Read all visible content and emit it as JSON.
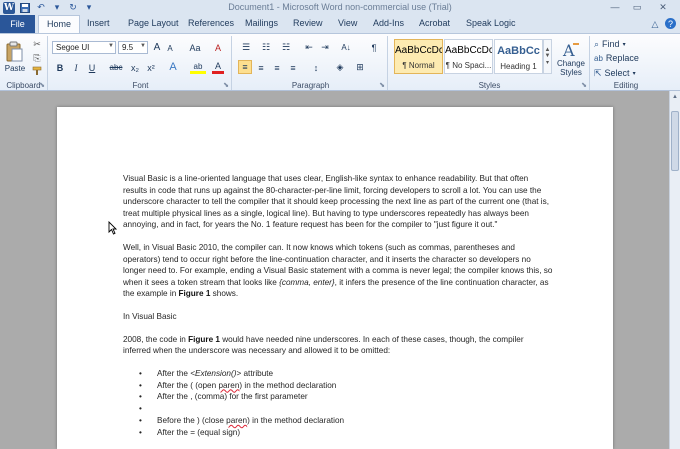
{
  "window": {
    "title": "Document1 - Microsoft Word non-commercial use (Trial)",
    "logo": "W",
    "qat": [
      {
        "name": "save-icon",
        "glyph": "💾"
      },
      {
        "name": "undo-icon",
        "glyph": "↶"
      },
      {
        "name": "redo-icon",
        "glyph": "↻"
      },
      {
        "name": "customize-qat-icon",
        "glyph": "▾"
      }
    ],
    "controls": {
      "minimize": "—",
      "maximize": "▭",
      "close": "✕"
    }
  },
  "tabs": {
    "file": "File",
    "items": [
      "Home",
      "Insert",
      "Page Layout",
      "References",
      "Mailings",
      "Review",
      "View",
      "Add-Ins",
      "Acrobat",
      "Speak Logic"
    ],
    "active": "Home",
    "minimize_ribbon": "△",
    "help": "?"
  },
  "ribbon": {
    "clipboard": {
      "label": "Clipboard",
      "paste": "Paste",
      "cut": "✂",
      "copy": "⎘",
      "format_painter": "🖌"
    },
    "font": {
      "label": "Font",
      "font_name": "Segoe UI",
      "font_size": "9.5",
      "grow": "A",
      "shrink": "A",
      "change_case": "Aa",
      "clear": "A",
      "bold": "B",
      "italic": "I",
      "underline": "U",
      "strikethrough": "abc",
      "subscript": "x₂",
      "superscript": "x²",
      "text_effects": "A",
      "highlight": "ab",
      "font_color": "A"
    },
    "paragraph": {
      "label": "Paragraph",
      "bullets": "☰",
      "numbering": "☷",
      "multilevel": "☵",
      "decrease_indent": "⇤",
      "increase_indent": "⇥",
      "sort": "A↓",
      "show_marks": "¶",
      "align_left": "≡",
      "center": "≡",
      "align_right": "≡",
      "justify": "≡",
      "line_spacing": "↕",
      "shading": "◈",
      "borders": "⊞"
    },
    "styles": {
      "label": "Styles",
      "items": [
        {
          "sample": "AaBbCcDc",
          "name": "¶ Normal",
          "selected": true
        },
        {
          "sample": "AaBbCcDc",
          "name": "¶ No Spaci...",
          "selected": false
        },
        {
          "sample": "AaBbCc",
          "name": "Heading 1",
          "selected": false
        }
      ],
      "change_styles": "Change Styles"
    },
    "editing": {
      "label": "Editing",
      "find": "Find",
      "replace": "Replace",
      "select": "Select"
    }
  },
  "document": {
    "p1": "Visual Basic is a line-oriented language that uses clear, English-like syntax to enhance readability. But that often results in code that runs up against the 80-character-per-line limit, forcing developers to scroll a lot. You can use the underscore character to tell the compiler that it should keep processing the next line as part of the current one (that is, treat multiple physical lines as a single, logical line). But having to type underscores repeatedly has always been annoying, and in fact, for years the No. 1 feature request has been for the compiler to \"just figure it out.\"",
    "p2_a": "Well, in Visual Basic 2010, the compiler can. It now knows which tokens (such as commas, parentheses and operators) tend to occur right before the line-continuation character, and it inserts the character so developers no longer need to. For example, ending a Visual Basic statement with a comma is never legal; the compiler knows this, so when it sees a token stream that looks like ",
    "p2_italic": "{comma, enter}",
    "p2_b": ", it infers the presence of the line continuation character, as the example in ",
    "p2_bold": "Figure 1",
    "p2_c": " shows.",
    "p3": "In Visual Basic",
    "p4_a": "2008, the code in ",
    "p4_bold": "Figure 1",
    "p4_b": " would have needed nine underscores. In each of these cases, though, the compiler inferred when the underscore was necessary and allowed it to be omitted:",
    "bullets": [
      {
        "pre": "After the ",
        "italic": "<Extension()>",
        "post": " attribute"
      },
      {
        "pre": "After the ( (open ",
        "squiggle": "paren",
        "post": ") in the method declaration"
      },
      {
        "pre": "After the , (comma) for the first parameter",
        "squiggle": "",
        "post": ""
      },
      {
        "pre": "",
        "squiggle": "",
        "post": ""
      },
      {
        "pre": "Before the ) (close ",
        "squiggle": "paren",
        "post": ") in the method declaration"
      },
      {
        "pre": "After the = (equal sign)",
        "squiggle": "",
        "post": ""
      }
    ]
  },
  "scrollbar": {
    "up": "▲",
    "down": "▼"
  },
  "colors": {
    "file_tab": "#2a5699",
    "ribbon_bg": "#fdfdfe",
    "doc_bg": "#ababab",
    "selected_style": "#fdebb1"
  }
}
